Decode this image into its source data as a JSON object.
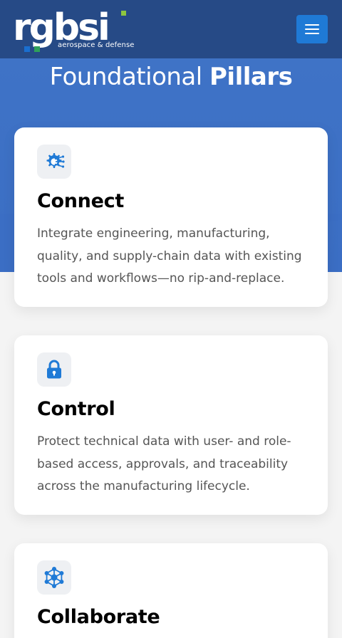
{
  "header": {
    "logo_word": "rgbsi",
    "logo_tagline": "aerospace & defense",
    "menu_label": "Menu"
  },
  "section": {
    "title_light": "Foundational",
    "title_bold": "Pillars"
  },
  "cards": [
    {
      "icon": "gear-network-icon",
      "title": "Connect",
      "text": "Integrate engineering, manufacturing, quality, and supply-chain data with existing tools and workflows—no rip-and-replace."
    },
    {
      "icon": "lock-icon",
      "title": "Control",
      "text": "Protect technical data with user- and role-based access, approvals, and traceability across the manufacturing lifecycle."
    },
    {
      "icon": "network-nodes-icon",
      "title": "Collaborate",
      "text": ""
    }
  ],
  "colors": {
    "header_bg": "#264a86",
    "hero_bg": "#3f73c6",
    "accent_blue": "#1f7ad6",
    "logo_square_blue": "#1a6fd0",
    "logo_square_green": "#8dc63f"
  }
}
